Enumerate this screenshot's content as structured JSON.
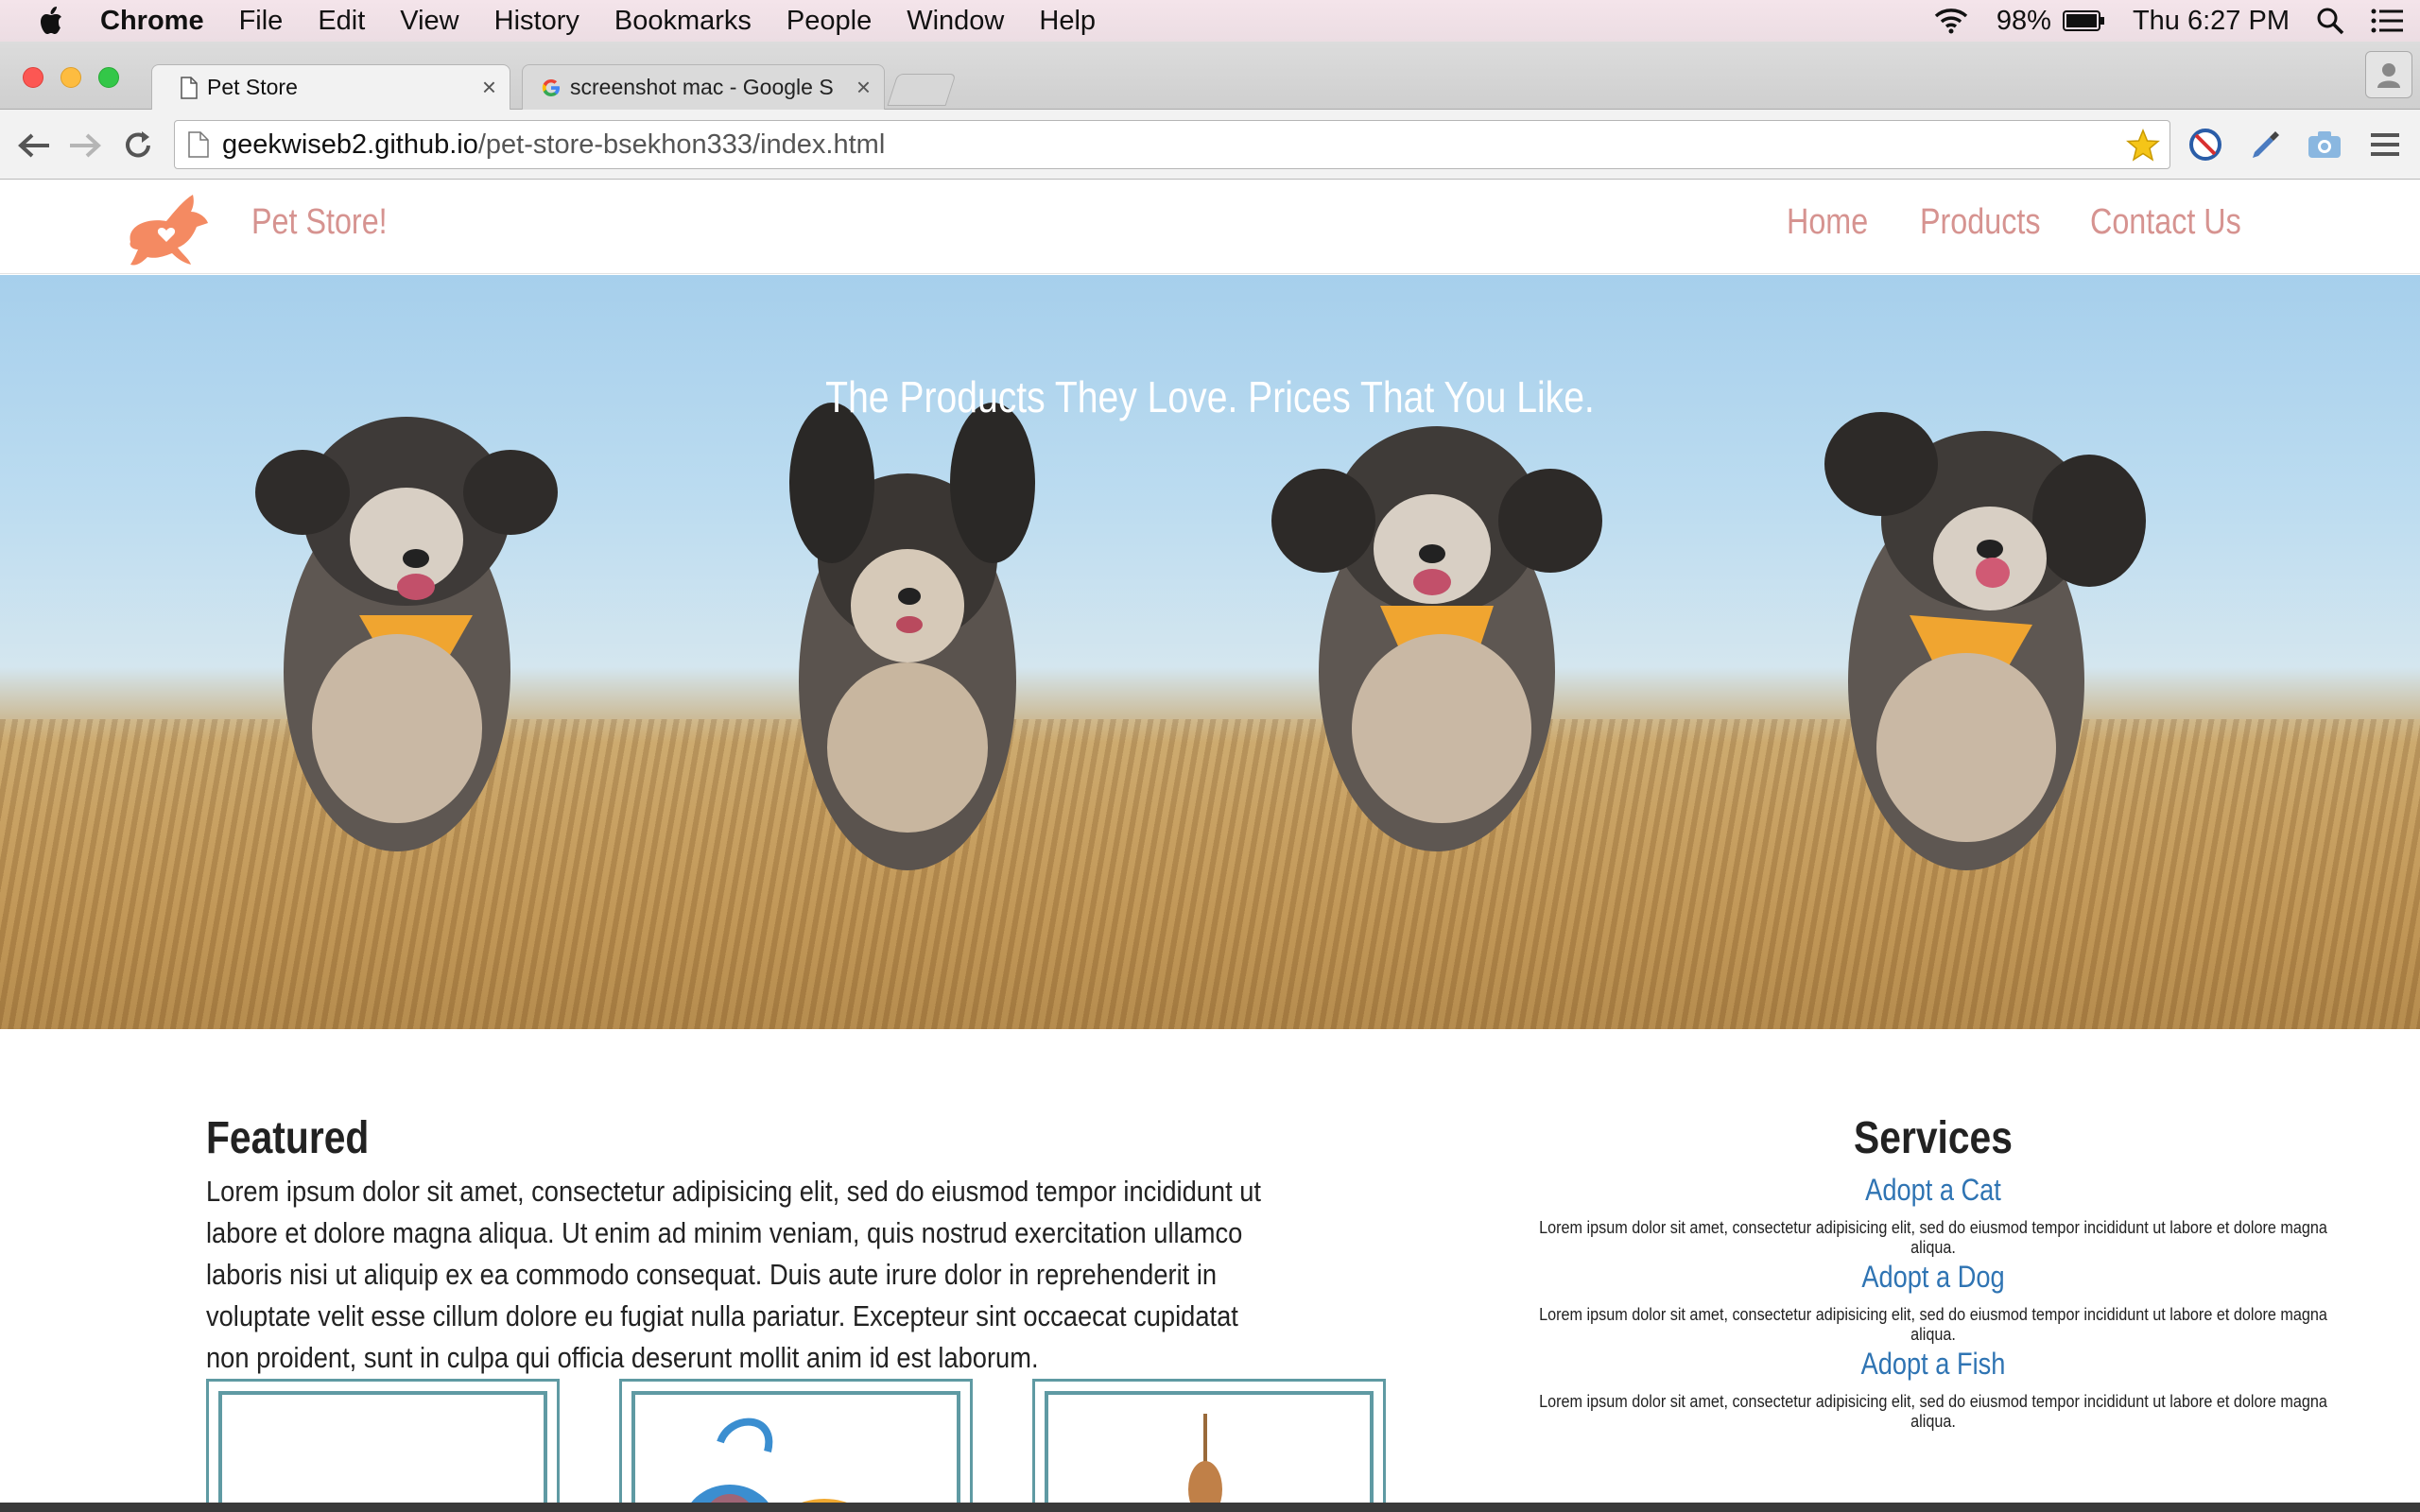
{
  "menubar": {
    "app": "Chrome",
    "items": [
      "File",
      "Edit",
      "View",
      "History",
      "Bookmarks",
      "People",
      "Window",
      "Help"
    ],
    "battery": "98%",
    "clock": "Thu 6:27 PM"
  },
  "tabs": [
    {
      "title": "Pet Store",
      "active": true
    },
    {
      "title": "screenshot mac - Google S",
      "active": false
    }
  ],
  "address": {
    "host": "geekwiseb2.github.io",
    "path": "/pet-store-bsekhon333/index.html"
  },
  "site": {
    "brand": "Pet Store!",
    "nav": [
      "Home",
      "Products",
      "Contact Us"
    ],
    "hero_title": "The Products They Love. Prices That You Like.",
    "featured": {
      "heading": "Featured",
      "text": "Lorem ipsum dolor sit amet, consectetur adipisicing elit, sed do eiusmod tempor incididunt ut labore et dolore magna aliqua. Ut enim ad minim veniam, quis nostrud exercitation ullamco laboris nisi ut aliquip ex ea commodo consequat. Duis aute irure dolor in reprehenderit in voluptate velit esse cillum dolore eu fugiat nulla pariatur. Excepteur sint occaecat cupidatat non proident, sunt in culpa qui officia deserunt mollit anim id est laborum."
    },
    "services": {
      "heading": "Services",
      "items": [
        {
          "title": "Adopt a Cat",
          "text": "Lorem ipsum dolor sit amet, consectetur adipisicing elit, sed do eiusmod tempor incididunt ut labore et dolore magna aliqua."
        },
        {
          "title": "Adopt a Dog",
          "text": "Lorem ipsum dolor sit amet, consectetur adipisicing elit, sed do eiusmod tempor incididunt ut labore et dolore magna aliqua."
        },
        {
          "title": "Adopt a Fish",
          "text": "Lorem ipsum dolor sit amet, consectetur adipisicing elit, sed do eiusmod tempor incididunt ut labore et dolore magna aliqua."
        }
      ]
    }
  },
  "colors": {
    "brand": "#d69390",
    "link": "#2f74b3",
    "card_border": "#5f9aa3"
  }
}
